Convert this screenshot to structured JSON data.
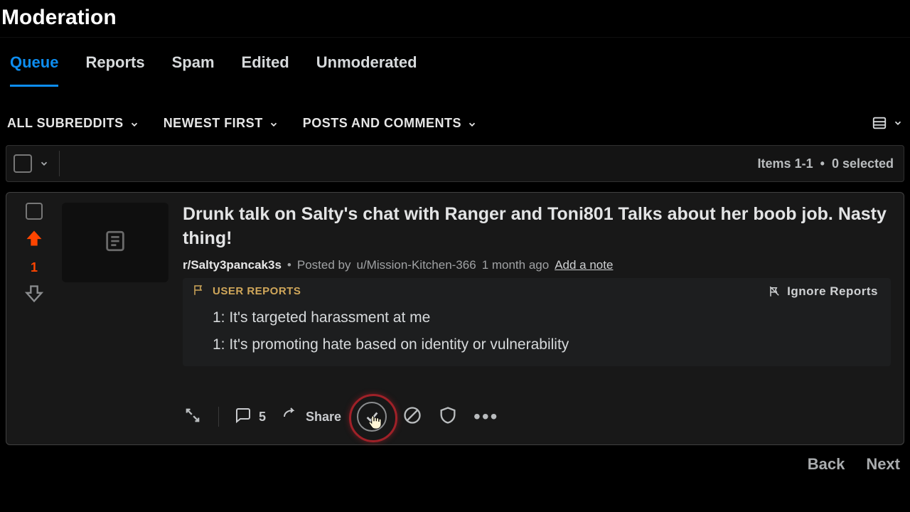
{
  "header": {
    "title": "Moderation"
  },
  "tabs": {
    "items": [
      {
        "label": "Queue",
        "active": true
      },
      {
        "label": "Reports"
      },
      {
        "label": "Spam"
      },
      {
        "label": "Edited"
      },
      {
        "label": "Unmoderated"
      }
    ]
  },
  "filters": {
    "subreddits": "ALL SUBREDDITS",
    "sort": "NEWEST FIRST",
    "type": "POSTS AND COMMENTS"
  },
  "list_header": {
    "range": "Items 1-1",
    "separator": "•",
    "selected": "0 selected"
  },
  "post": {
    "score": "1",
    "title": "Drunk talk on Salty's chat with Ranger and Toni801 Talks about her boob job. Nasty thing!",
    "subreddit": "r/Salty3pancak3s",
    "posted_by_prefix": "Posted by",
    "author": "u/Mission-Kitchen-366",
    "age": "1 month ago",
    "add_note": "Add a note",
    "user_reports_label": "USER REPORTS",
    "ignore_reports_label": "Ignore Reports",
    "reports": [
      "1: It's targeted harassment at me",
      "1: It's promoting hate based on identity or vulnerability"
    ],
    "comments_count": "5",
    "share_label": "Share"
  },
  "pager": {
    "back": "Back",
    "next": "Next"
  }
}
